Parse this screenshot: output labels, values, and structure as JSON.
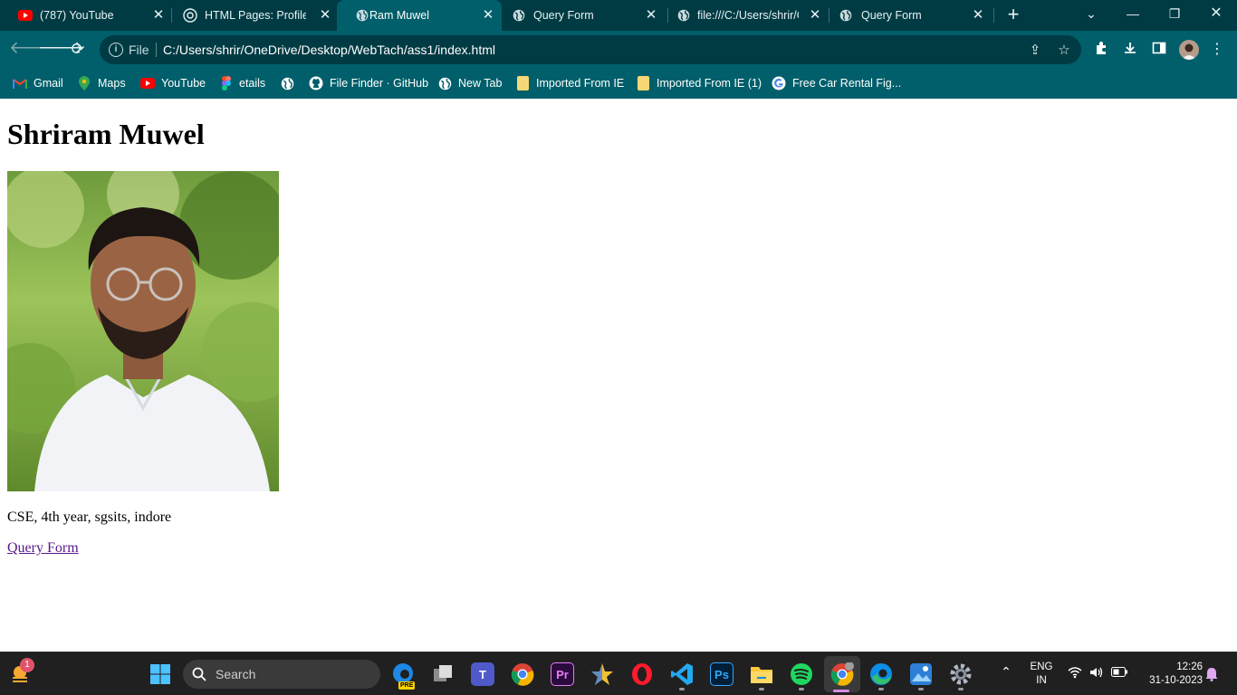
{
  "browser": {
    "tabs": [
      {
        "title": "(787) YouTube",
        "favicon": "youtube-icon"
      },
      {
        "title": "HTML Pages: Profile, Q",
        "favicon": "chatgpt-icon"
      },
      {
        "title": "Ram Muwel",
        "favicon": "globe-icon",
        "active": true
      },
      {
        "title": "Query Form",
        "favicon": "globe-icon"
      },
      {
        "title": "file:///C:/Users/shrir/O",
        "favicon": "globe-icon"
      },
      {
        "title": "Query Form",
        "favicon": "globe-icon"
      }
    ],
    "address": {
      "scheme_label": "File",
      "url": "C:/Users/shrir/OneDrive/Desktop/WebTach/ass1/index.html"
    },
    "bookmarks": [
      {
        "label": "Gmail",
        "icon": "gmail-icon"
      },
      {
        "label": "Maps",
        "icon": "maps-icon"
      },
      {
        "label": "YouTube",
        "icon": "youtube-icon"
      },
      {
        "label": "etails",
        "icon": "figma-icon"
      },
      {
        "label": "",
        "icon": "globe-icon"
      },
      {
        "label": "File Finder · GitHub",
        "icon": "github-icon"
      },
      {
        "label": "New Tab",
        "icon": "globe-icon"
      },
      {
        "label": "Imported From IE",
        "icon": "folder-icon"
      },
      {
        "label": "Imported From IE (1)",
        "icon": "folder-icon"
      },
      {
        "label": "Free Car Rental Fig...",
        "icon": "google-icon"
      }
    ],
    "colors": {
      "frame": "#003b44",
      "toolbar": "#005f6b"
    }
  },
  "page": {
    "heading": "Shriram Muwel",
    "description": "CSE, 4th year, sgsits, indore",
    "link_label": "Query Form",
    "link_color": "#551a8b"
  },
  "taskbar": {
    "weather_badge": "1",
    "search_label": "Search",
    "language": {
      "line1": "ENG",
      "line2": "IN"
    },
    "time": "12:26",
    "date": "31-10-2023",
    "apps": [
      "premiere-icon",
      "photoshop-icon",
      "teams-icon"
    ],
    "app_labels": {
      "premiere": "Pr",
      "photoshop": "Ps",
      "teams": "T",
      "pre_badge": "PRE"
    }
  }
}
